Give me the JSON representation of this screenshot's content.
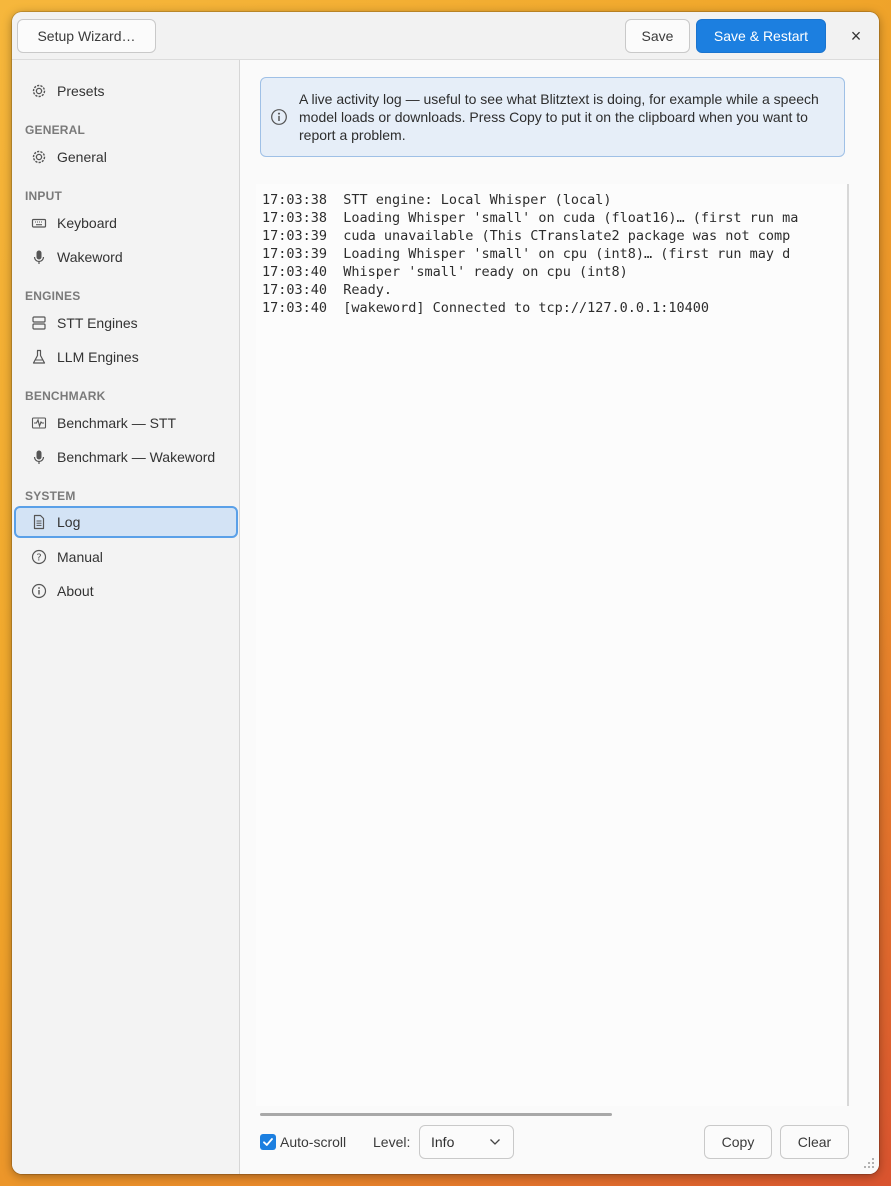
{
  "titlebar": {
    "setup_wizard_label": "Setup Wizard…",
    "save_label": "Save",
    "save_restart_label": "Save & Restart",
    "close_glyph": "×"
  },
  "sidebar": {
    "top_items": [
      {
        "label": "Presets",
        "icon": "gear-icon"
      }
    ],
    "sections": [
      {
        "title": "GENERAL",
        "items": [
          {
            "label": "General",
            "icon": "gear-icon"
          }
        ]
      },
      {
        "title": "INPUT",
        "items": [
          {
            "label": "Keyboard",
            "icon": "keyboard-icon"
          },
          {
            "label": "Wakeword",
            "icon": "microphone-icon"
          }
        ]
      },
      {
        "title": "ENGINES",
        "items": [
          {
            "label": "STT Engines",
            "icon": "server-icon"
          },
          {
            "label": "LLM Engines",
            "icon": "flask-icon"
          }
        ]
      },
      {
        "title": "BENCHMARK",
        "items": [
          {
            "label": "Benchmark — STT",
            "icon": "waveform-icon"
          },
          {
            "label": "Benchmark — Wakeword",
            "icon": "microphone-icon"
          }
        ]
      },
      {
        "title": "SYSTEM",
        "items": [
          {
            "label": "Log",
            "icon": "document-icon",
            "active": true
          },
          {
            "label": "Manual",
            "icon": "help-icon"
          },
          {
            "label": "About",
            "icon": "info-icon"
          }
        ]
      }
    ]
  },
  "info_banner": {
    "text": "A live activity log — useful to see what Blitztext is doing, for example while a speech model loads or downloads. Press Copy to put it on the clipboard when you want to report a problem."
  },
  "log": {
    "lines": [
      "17:03:38  STT engine: Local Whisper (local)",
      "17:03:38  Loading Whisper 'small' on cuda (float16)… (first run ma",
      "17:03:39  cuda unavailable (This CTranslate2 package was not comp",
      "17:03:39  Loading Whisper 'small' on cpu (int8)… (first run may d",
      "17:03:40  Whisper 'small' ready on cpu (int8)",
      "17:03:40  Ready.",
      "17:03:40  [wakeword] Connected to tcp://127.0.0.1:10400"
    ]
  },
  "footer": {
    "autoscroll_label": "Auto-scroll",
    "autoscroll_checked": true,
    "level_label": "Level:",
    "level_value": "Info",
    "copy_label": "Copy",
    "clear_label": "Clear"
  },
  "colors": {
    "accent": "#1c7fe0",
    "active_item_bg": "#d3e3f5",
    "info_bg": "#e6eef8"
  }
}
